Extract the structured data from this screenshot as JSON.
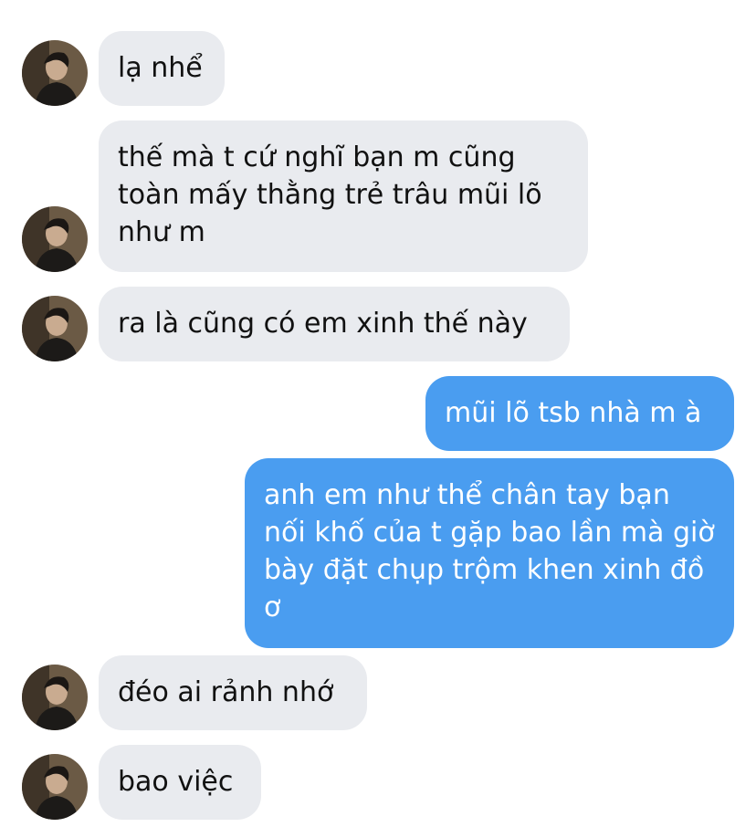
{
  "conversation": {
    "messages": [
      {
        "sender": "other",
        "text": "lạ nhể"
      },
      {
        "sender": "other",
        "text": "thế mà t cứ nghĩ bạn m cũng toàn mấy thằng trẻ trâu mũi lõ như m"
      },
      {
        "sender": "other",
        "text": "ra là cũng có em xinh thế này"
      },
      {
        "sender": "me",
        "text": "mũi lõ tsb nhà m à"
      },
      {
        "sender": "me",
        "text": "anh em như thể chân tay bạn nối khố của t gặp bao lần mà giờ bày đặt chụp trộm khen xinh đồ ơ"
      },
      {
        "sender": "other",
        "text": "đéo ai rảnh nhớ"
      },
      {
        "sender": "other",
        "text": "bao việc"
      }
    ]
  },
  "colors": {
    "incoming_bubble": "#e9ebef",
    "outgoing_bubble": "#4a9df0",
    "incoming_text": "#111111",
    "outgoing_text": "#ffffff"
  }
}
